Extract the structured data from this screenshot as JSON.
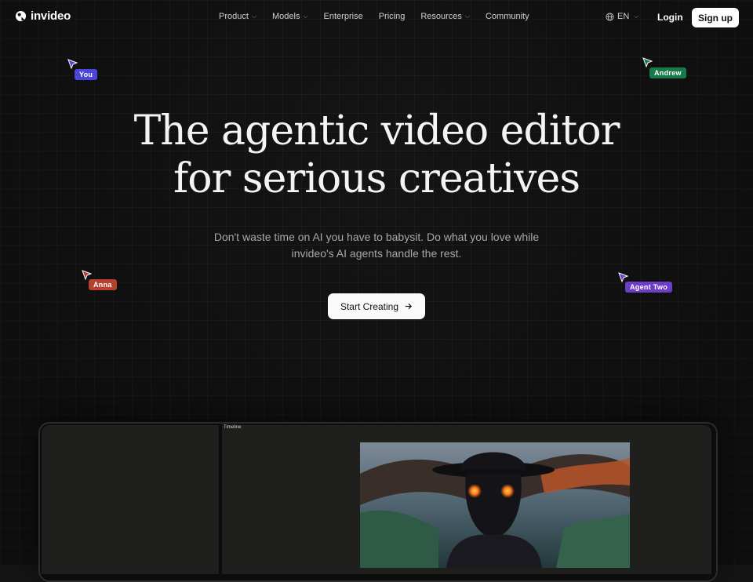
{
  "nav": {
    "logo_text": "invideo",
    "menu": [
      {
        "label": "Product",
        "has_dropdown": true
      },
      {
        "label": "Models",
        "has_dropdown": true
      },
      {
        "label": "Enterprise",
        "has_dropdown": false
      },
      {
        "label": "Pricing",
        "has_dropdown": false
      },
      {
        "label": "Resources",
        "has_dropdown": true
      },
      {
        "label": "Community",
        "has_dropdown": false
      }
    ],
    "language": "EN",
    "login_label": "Login",
    "signup_label": "Sign up"
  },
  "hero": {
    "title_line1": "The agentic video editor",
    "title_line2": "for serious creatives",
    "subtitle_line1": "Don't waste time on AI you have to babysit. Do what you love while",
    "subtitle_line2": "invideo's AI agents handle the rest.",
    "cta_label": "Start Creating"
  },
  "cursors": [
    {
      "name": "You",
      "color": "#4b45d8"
    },
    {
      "name": "Andrew",
      "color": "#177a4a"
    },
    {
      "name": "Anna",
      "color": "#b8402f"
    },
    {
      "name": "Agent Two",
      "color": "#6a3ec9"
    }
  ],
  "editor_preview": {
    "panel_label": "Timeline"
  },
  "colors": {
    "background": "#141414",
    "button_bg": "#ffffff"
  }
}
